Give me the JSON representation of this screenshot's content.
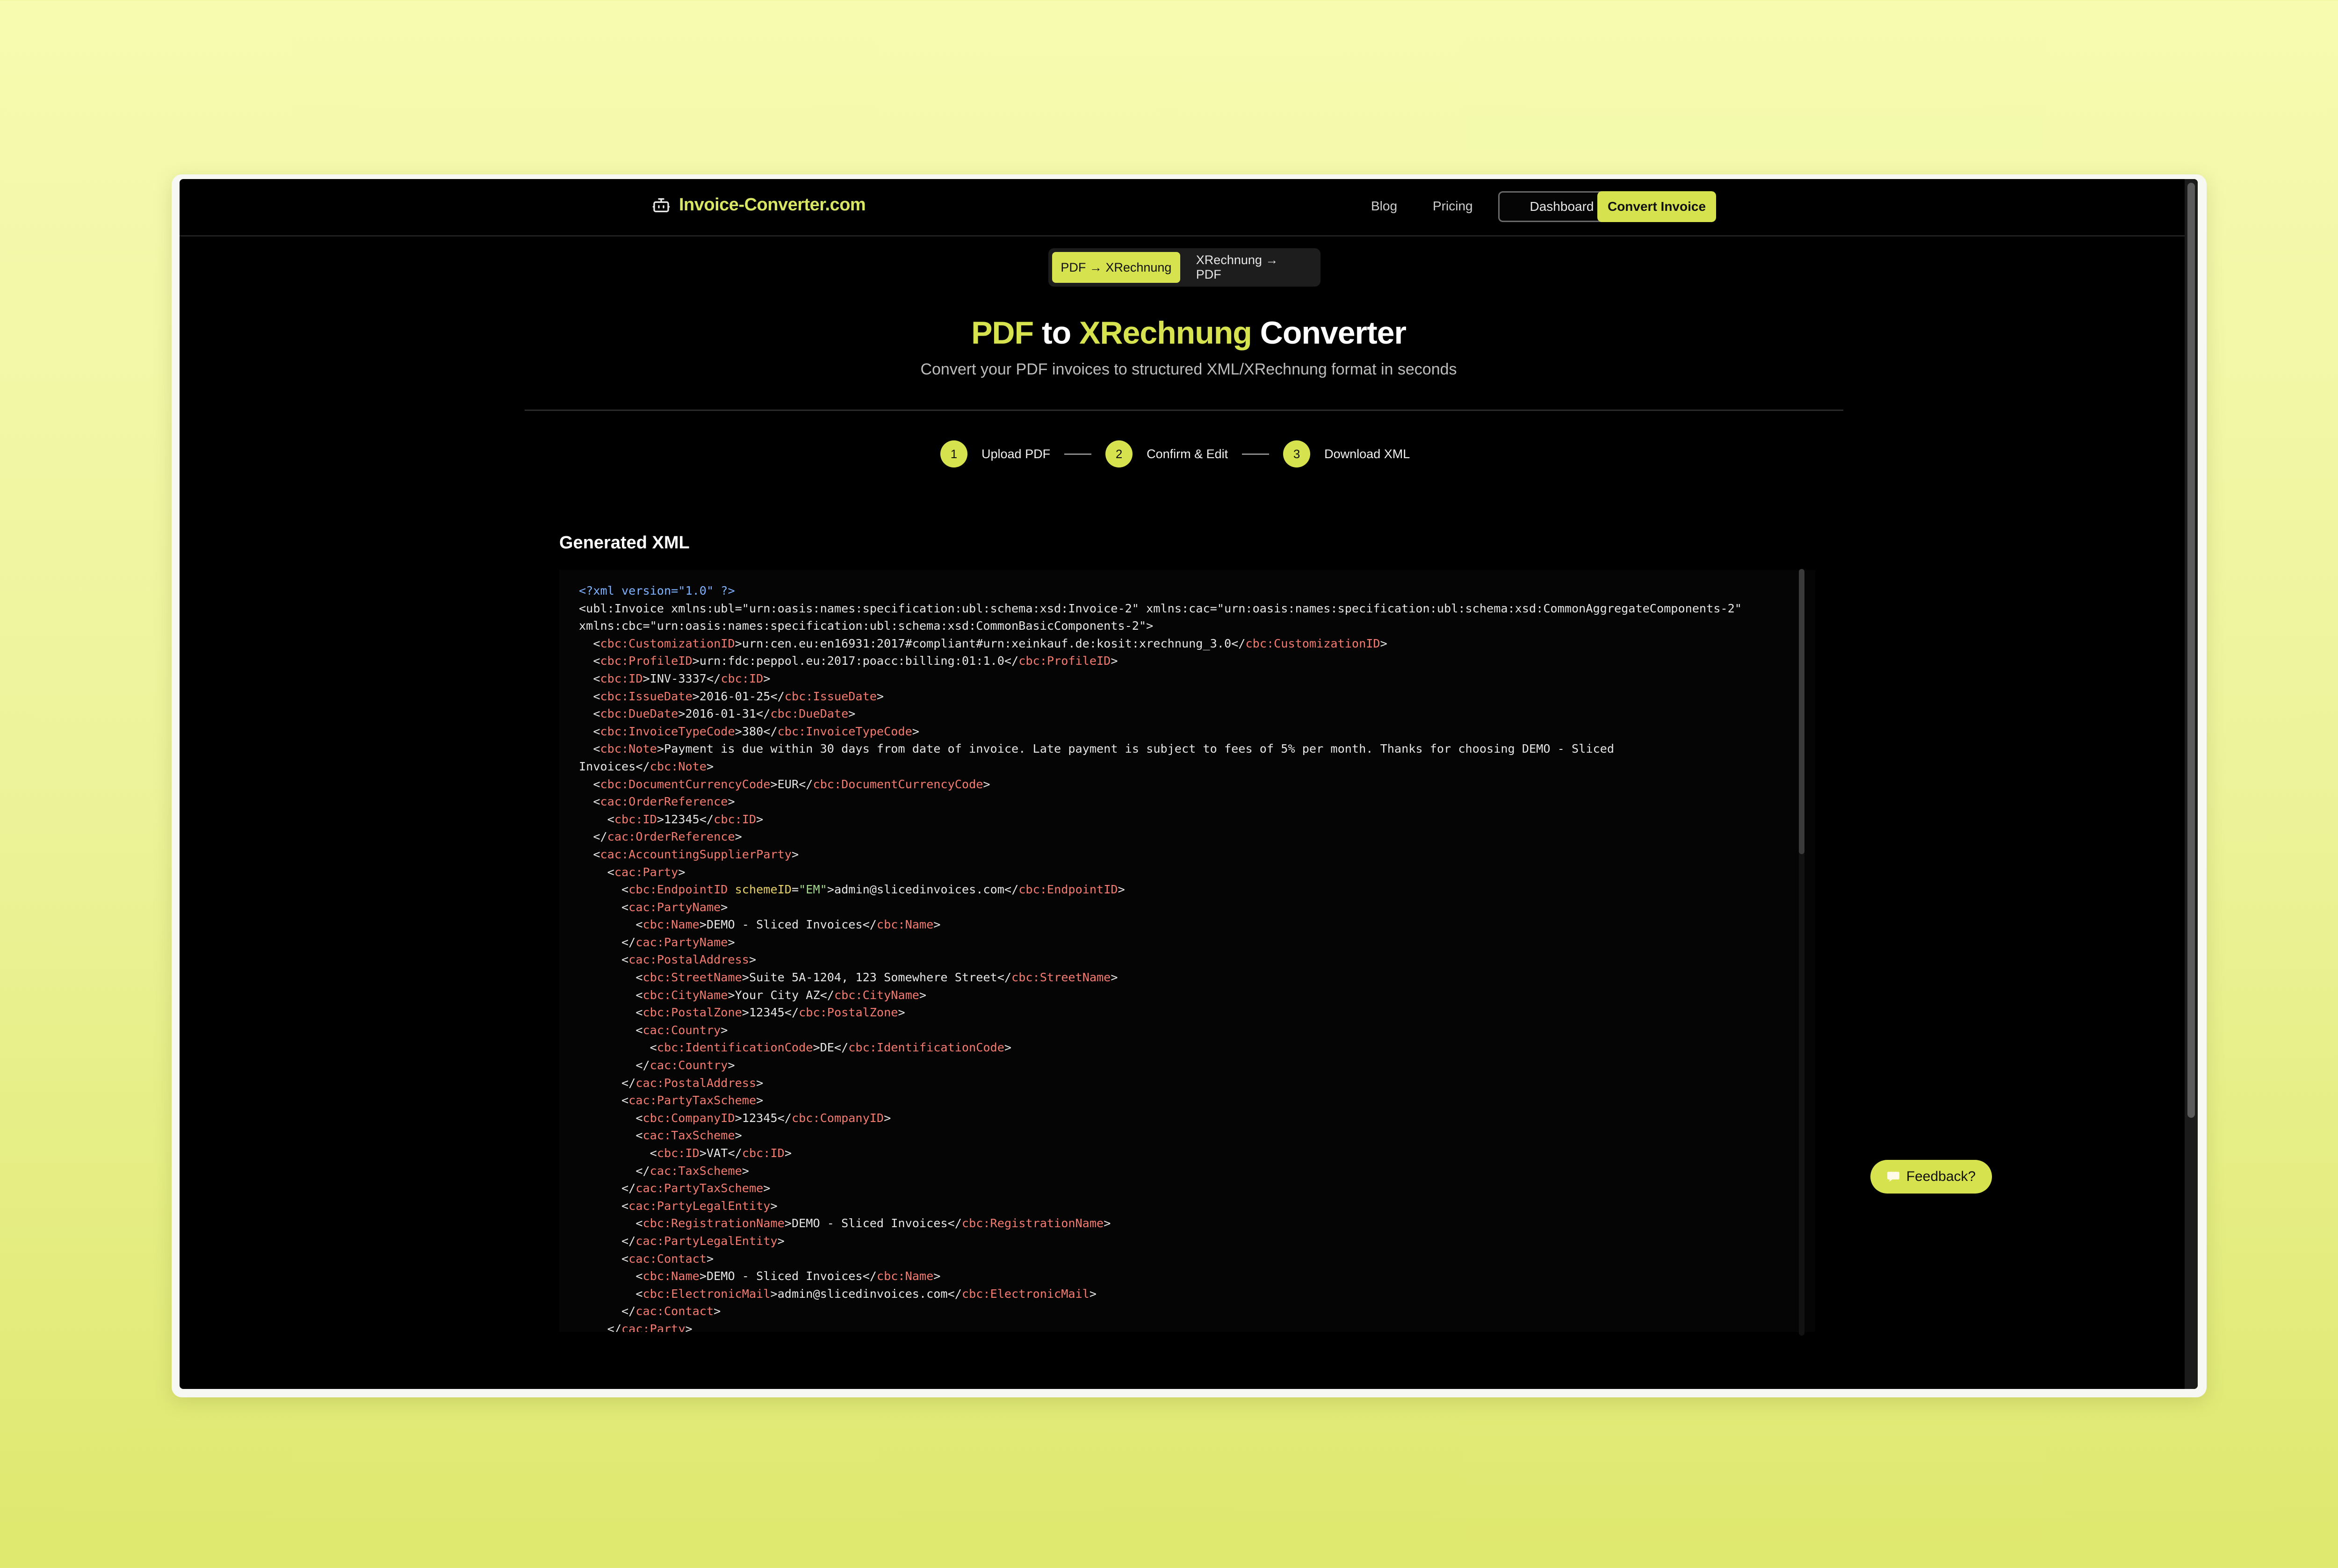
{
  "brand": {
    "name": "Invoice-Converter.com",
    "icon": "robot-icon"
  },
  "nav": {
    "blog": "Blog",
    "pricing": "Pricing",
    "dashboard": "Dashboard",
    "convert": "Convert Invoice"
  },
  "mode_toggle": {
    "pdf_to_xml": "PDF → XRechnung",
    "xml_to_pdf": "XRechnung → PDF",
    "active": "pdf_to_xml"
  },
  "hero": {
    "title_part1": "PDF",
    "title_part2": " to ",
    "title_part3": "XRechnung",
    "title_part4": " Converter",
    "subtitle": "Convert your PDF invoices to structured XML/XRechnung format in seconds"
  },
  "steps": [
    {
      "number": "1",
      "label": "Upload PDF"
    },
    {
      "number": "2",
      "label": "Confirm & Edit"
    },
    {
      "number": "3",
      "label": "Download XML"
    }
  ],
  "section_title": "Generated XML",
  "xml_lines": [
    "<?xml version=\"1.0\" ?>",
    "<ubl:Invoice xmlns:ubl=\"urn:oasis:names:specification:ubl:schema:xsd:Invoice-2\" xmlns:cac=\"urn:oasis:names:specification:ubl:schema:xsd:CommonAggregateComponents-2\"",
    "xmlns:cbc=\"urn:oasis:names:specification:ubl:schema:xsd:CommonBasicComponents-2\">",
    "  <cbc:CustomizationID>urn:cen.eu:en16931:2017#compliant#urn:xeinkauf.de:kosit:xrechnung_3.0</cbc:CustomizationID>",
    "  <cbc:ProfileID>urn:fdc:peppol.eu:2017:poacc:billing:01:1.0</cbc:ProfileID>",
    "  <cbc:ID>INV-3337</cbc:ID>",
    "  <cbc:IssueDate>2016-01-25</cbc:IssueDate>",
    "  <cbc:DueDate>2016-01-31</cbc:DueDate>",
    "  <cbc:InvoiceTypeCode>380</cbc:InvoiceTypeCode>",
    "  <cbc:Note>Payment is due within 30 days from date of invoice. Late payment is subject to fees of 5% per month. Thanks for choosing DEMO - Sliced",
    "Invoices</cbc:Note>",
    "  <cbc:DocumentCurrencyCode>EUR</cbc:DocumentCurrencyCode>",
    "  <cac:OrderReference>",
    "    <cbc:ID>12345</cbc:ID>",
    "  </cac:OrderReference>",
    "  <cac:AccountingSupplierParty>",
    "    <cac:Party>",
    "      <cbc:EndpointID schemeID=\"EM\">admin@slicedinvoices.com</cbc:EndpointID>",
    "      <cac:PartyName>",
    "        <cbc:Name>DEMO - Sliced Invoices</cbc:Name>",
    "      </cac:PartyName>",
    "      <cac:PostalAddress>",
    "        <cbc:StreetName>Suite 5A-1204, 123 Somewhere Street</cbc:StreetName>",
    "        <cbc:CityName>Your City AZ</cbc:CityName>",
    "        <cbc:PostalZone>12345</cbc:PostalZone>",
    "        <cac:Country>",
    "          <cbc:IdentificationCode>DE</cbc:IdentificationCode>",
    "        </cac:Country>",
    "      </cac:PostalAddress>",
    "      <cac:PartyTaxScheme>",
    "        <cbc:CompanyID>12345</cbc:CompanyID>",
    "        <cac:TaxScheme>",
    "          <cbc:ID>VAT</cbc:ID>",
    "        </cac:TaxScheme>",
    "      </cac:PartyTaxScheme>",
    "      <cac:PartyLegalEntity>",
    "        <cbc:RegistrationName>DEMO - Sliced Invoices</cbc:RegistrationName>",
    "      </cac:PartyLegalEntity>",
    "      <cac:Contact>",
    "        <cbc:Name>DEMO - Sliced Invoices</cbc:Name>",
    "        <cbc:ElectronicMail>admin@slicedinvoices.com</cbc:ElectronicMail>",
    "      </cac:Contact>",
    "    </cac:Party>"
  ],
  "feedback": {
    "label": "Feedback?",
    "icon": "chat-bubble-icon"
  },
  "colors": {
    "accent": "#d7e24f",
    "brand_text": "#d9e663",
    "xml_tag": "#f47b70",
    "xml_attr": "#e8d36a",
    "xml_value": "#a5db8e",
    "xml_decl": "#7fb3ff"
  }
}
